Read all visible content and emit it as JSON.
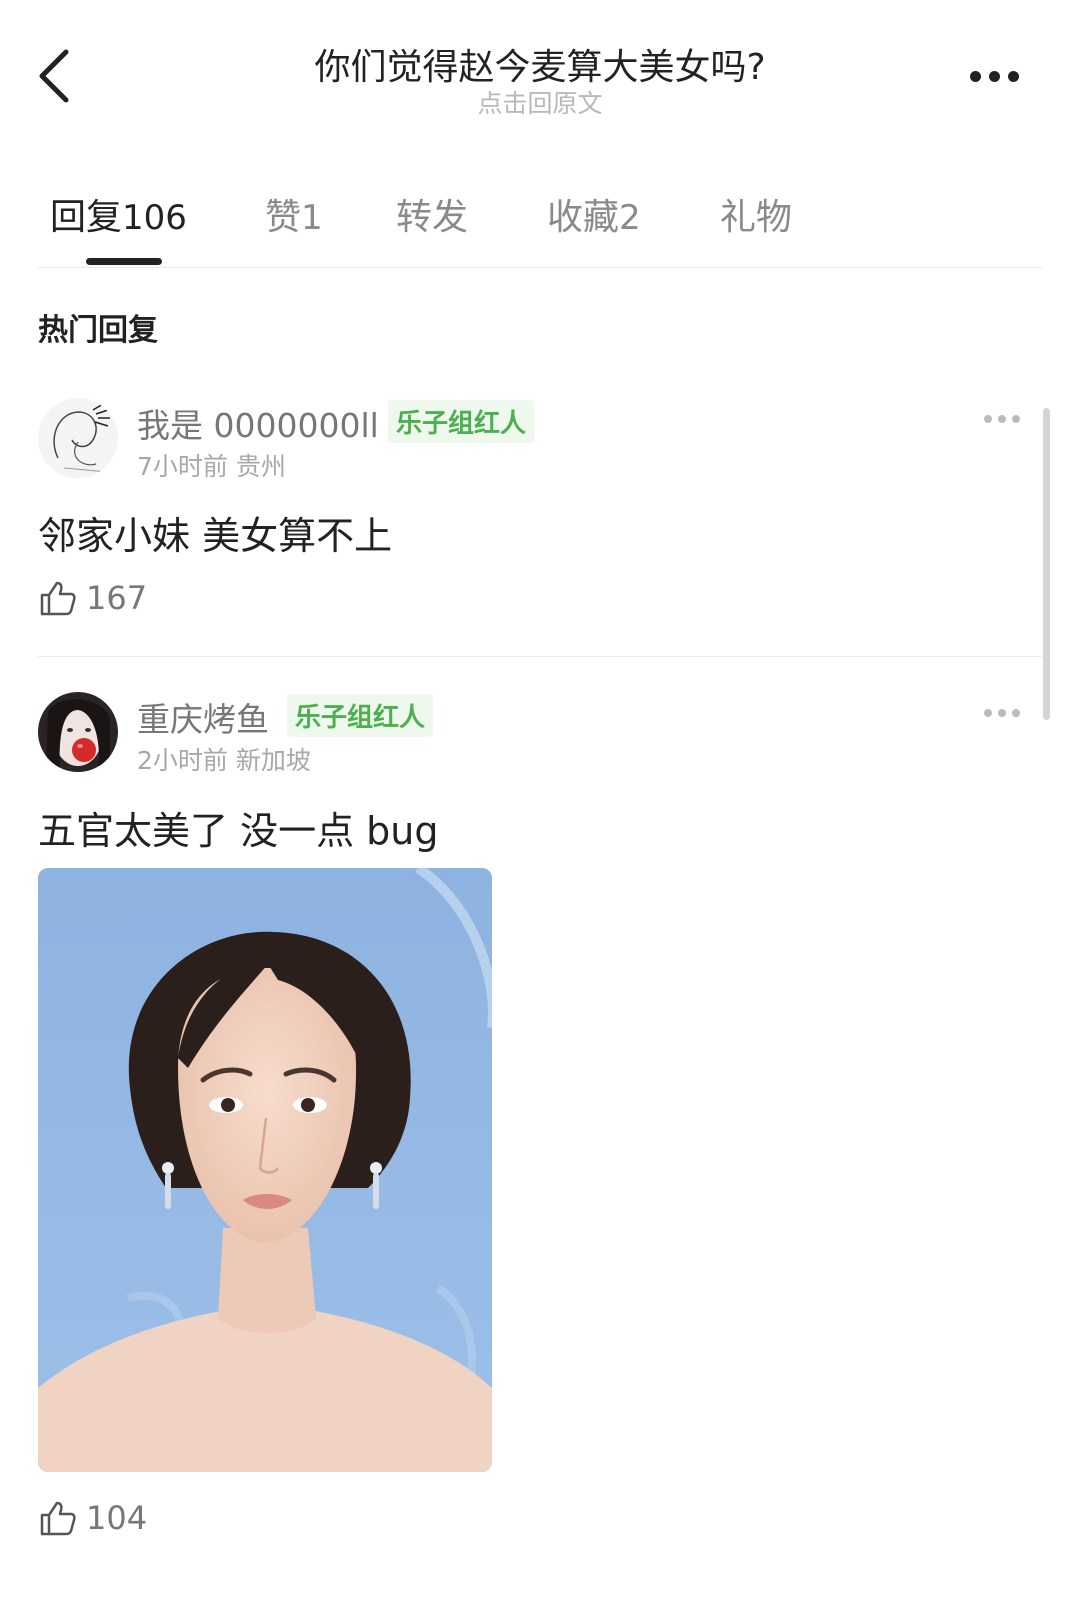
{
  "header": {
    "title": "你们觉得赵今麦算大美女吗?",
    "subtitle": "点击回原文",
    "back_icon": "chevron-left-icon",
    "more_icon": "more-horizontal-icon"
  },
  "tabs": [
    {
      "label": "回复",
      "count": "106",
      "active": true
    },
    {
      "label": "赞",
      "count": "1"
    },
    {
      "label": "转发",
      "count": ""
    },
    {
      "label": "收藏",
      "count": "2"
    },
    {
      "label": "礼物",
      "count": ""
    }
  ],
  "section_title": "热门回复",
  "posts": [
    {
      "username": "我是 0000000ll",
      "badge": "乐子组红人",
      "time": "7小时前",
      "location": "贵州",
      "content": "邻家小妹 美女算不上",
      "likes": "167"
    },
    {
      "username": "重庆烤鱼",
      "badge": "乐子组红人",
      "time": "2小时前",
      "location": "新加坡",
      "content": "五官太美了 没一点 bug",
      "likes": "104"
    }
  ],
  "colors": {
    "badge_text": "#4caf50",
    "badge_bg": "#eef8ec",
    "image_background": "#8fb6e3"
  }
}
